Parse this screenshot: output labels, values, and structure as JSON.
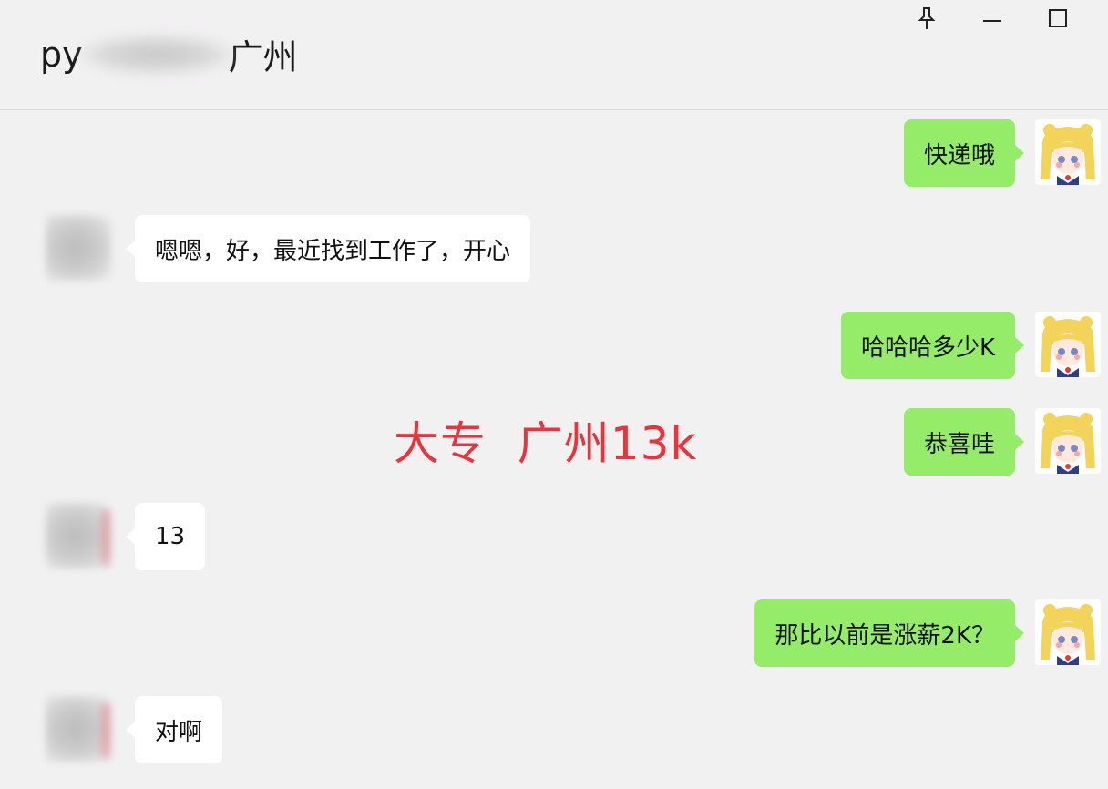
{
  "header": {
    "title_prefix": "py",
    "title_suffix": "广州",
    "controls": [
      "pin-icon",
      "minimize-icon",
      "maximize-icon"
    ]
  },
  "messages": [
    {
      "side": "right",
      "text": "快递哦"
    },
    {
      "side": "left",
      "text": "嗯嗯，好，最近找到工作了，开心"
    },
    {
      "side": "right",
      "text": "哈哈哈多少K"
    },
    {
      "side": "right",
      "text": "恭喜哇"
    },
    {
      "side": "left",
      "text": "13"
    },
    {
      "side": "right",
      "text": "那比以前是涨薪2K？"
    },
    {
      "side": "left",
      "text": "对啊"
    }
  ],
  "overlay": {
    "caption": "大专  广州13k",
    "color": "#e8343a"
  },
  "colors": {
    "self_bubble": "#95ec69",
    "other_bubble": "#ffffff",
    "background": "#f2f1f2"
  }
}
